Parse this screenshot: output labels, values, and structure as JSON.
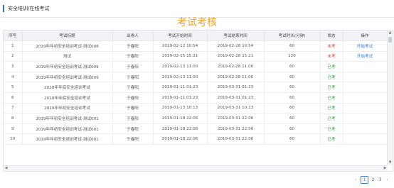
{
  "breadcrumb": "安全培训/在线考试",
  "page_title": "考试考核",
  "columns": [
    "序号",
    "考试标题",
    "出卷人",
    "考试开始时间",
    "考试结束时间",
    "考试时长(分钟)",
    "状态",
    "操作"
  ],
  "rows": [
    {
      "no": "1",
      "title": "2019年年初安全培训考试-测试008",
      "author": "于春阳",
      "start": "2019-02-12 10:54",
      "end": "2019-02-28 10:54",
      "duration": "60",
      "status": "未考",
      "status_type": "not",
      "action": "开始考试"
    },
    {
      "no": "2",
      "title": "测试",
      "author": "于春阳",
      "start": "2019-02-15 15:21",
      "end": "2019-02-28 15:21",
      "duration": "120",
      "status": "未考",
      "status_type": "not",
      "action": "开始考试"
    },
    {
      "no": "3",
      "title": "2019年年初安全培训考试-测试009",
      "author": "于春阳",
      "start": "2019-02-13 11:00",
      "end": "2019-02-28 11:00",
      "duration": "60",
      "status": "已考",
      "status_type": "done",
      "action": ""
    },
    {
      "no": "4",
      "title": "2019年年初安全培训考试-测试009",
      "author": "于春阳",
      "start": "2019-02-13 11:00",
      "end": "2019-02-28 11:00",
      "duration": "60",
      "status": "已考",
      "status_type": "done",
      "action": ""
    },
    {
      "no": "5",
      "title": "2018年年底安全培训考试",
      "author": "于春阳",
      "start": "2019-01-11 01:23",
      "end": "2019-03-31 01:23",
      "duration": "60",
      "status": "已考",
      "status_type": "done",
      "action": ""
    },
    {
      "no": "6",
      "title": "2018年年底安全培训考试",
      "author": "于春阳",
      "start": "2019-01-11 01:23",
      "end": "2019-03-31 01:23",
      "duration": "60",
      "status": "已考",
      "status_type": "done",
      "action": ""
    },
    {
      "no": "7",
      "title": "2019年年初安全培训考试",
      "author": "于春阳",
      "start": "2019-01-13 10:13",
      "end": "2019-03-31 10:13",
      "duration": "60",
      "status": "已考",
      "status_type": "done",
      "action": ""
    },
    {
      "no": "8",
      "title": "2019年年初安全培训考试-测试001",
      "author": "于春阳",
      "start": "2019-01-18 22:06",
      "end": "2019-03-31 22:06",
      "duration": "60",
      "status": "已考",
      "status_type": "done",
      "action": ""
    },
    {
      "no": "9",
      "title": "2019年年初安全培训考试-测试001",
      "author": "于春阳",
      "start": "2019-01-18 22:06",
      "end": "2019-03-31 22:06",
      "duration": "60",
      "status": "已考",
      "status_type": "done",
      "action": ""
    },
    {
      "no": "10",
      "title": "2019年年初安全培训考试-测试001",
      "author": "于春阳",
      "start": "2019-01-18 22:06",
      "end": "2019-03-31 22:06",
      "duration": "60",
      "status": "已考",
      "status_type": "done",
      "action": ""
    }
  ],
  "pager": {
    "prev": "‹",
    "pages": [
      "1",
      "2",
      "3"
    ],
    "current": "1",
    "next": "›"
  },
  "colors": {
    "accent": "#2e6bd6",
    "title": "#f0a22e",
    "status_not": "#e04040",
    "status_done": "#2ea043",
    "link": "#2f7de1"
  }
}
